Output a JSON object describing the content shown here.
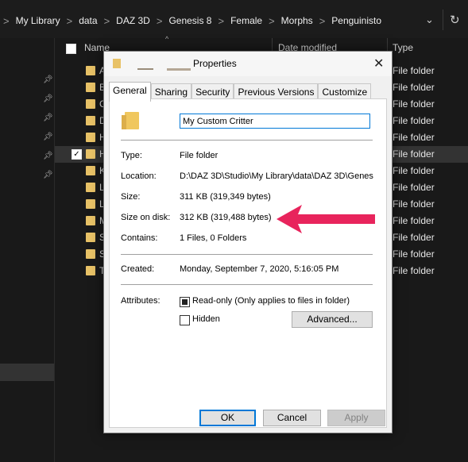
{
  "explorer": {
    "breadcrumb": [
      "My Library",
      "data",
      "DAZ 3D",
      "Genesis 8",
      "Female",
      "Morphs",
      "Penguinisto"
    ],
    "separator": ">",
    "columns": {
      "name": "Name",
      "date": "Date modified",
      "type": "Type"
    },
    "rows": [
      {
        "letter": "A",
        "type": "File folder"
      },
      {
        "letter": "B",
        "type": "File folder"
      },
      {
        "letter": "C",
        "type": "File folder"
      },
      {
        "letter": "D",
        "type": "File folder"
      },
      {
        "letter": "H",
        "type": "File folder"
      },
      {
        "letter": "H",
        "type": "File folder"
      },
      {
        "letter": "K",
        "type": "File folder"
      },
      {
        "letter": "L",
        "type": "File folder"
      },
      {
        "letter": "L",
        "type": "File folder"
      },
      {
        "letter": "M",
        "type": "File folder"
      },
      {
        "letter": "S",
        "type": "File folder"
      },
      {
        "letter": "S",
        "type": "File folder"
      },
      {
        "letter": "T",
        "type": "File folder"
      }
    ],
    "selected_row_index": 5,
    "icons": {
      "refresh": "refresh-icon",
      "dropdown": "chevron-down-icon",
      "pin": "pin-icon",
      "folder": "folder-icon"
    }
  },
  "dialog": {
    "title": "Properties",
    "tabs": [
      "General",
      "Sharing",
      "Security",
      "Previous Versions",
      "Customize"
    ],
    "active_tab": "General",
    "folder_name": "My Custom Critter",
    "fields": {
      "type_label": "Type:",
      "type_value": "File folder",
      "location_label": "Location:",
      "location_value": "D:\\DAZ 3D\\Studio\\My Library\\data\\DAZ 3D\\Genes",
      "size_label": "Size:",
      "size_value": "311 KB (319,349 bytes)",
      "size_on_disk_label": "Size on disk:",
      "size_on_disk_value": "312 KB (319,488 bytes)",
      "contains_label": "Contains:",
      "contains_value": "1 Files, 0 Folders",
      "created_label": "Created:",
      "created_value": "Monday, September 7, 2020, 5:16:05 PM",
      "attributes_label": "Attributes:"
    },
    "attributes": {
      "readonly_label": "Read-only (Only applies to files in folder)",
      "readonly_state": "indeterminate",
      "hidden_label": "Hidden",
      "hidden_checked": false,
      "advanced_label": "Advanced..."
    },
    "buttons": {
      "ok": "OK",
      "cancel": "Cancel",
      "apply": "Apply"
    },
    "close_glyph": "✕"
  },
  "annotation": {
    "arrow_color": "#e8245c"
  }
}
